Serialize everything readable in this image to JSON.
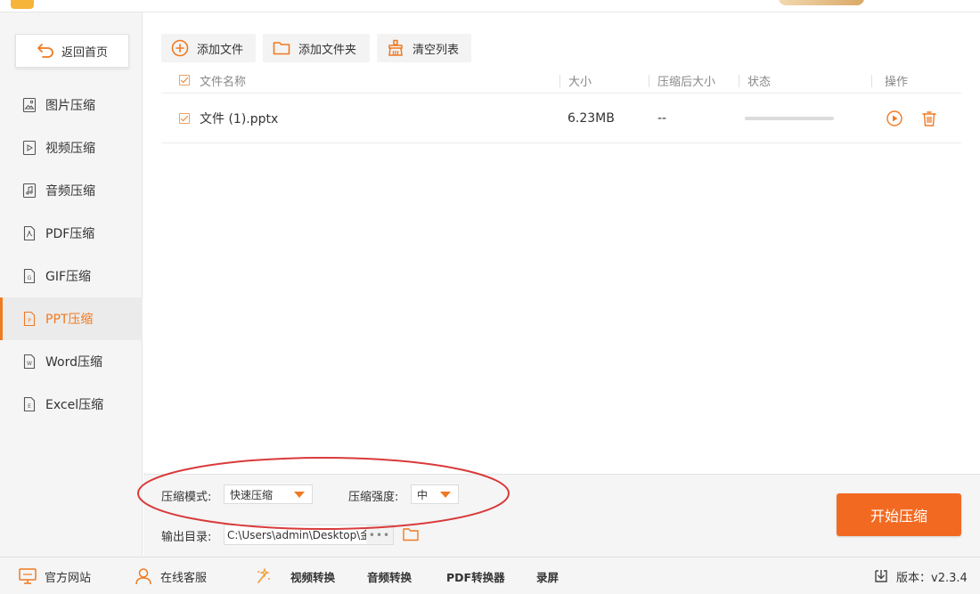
{
  "sidebar": {
    "back_label": "返回首页",
    "items": [
      {
        "label": "图片压缩",
        "icon": "image-file-icon"
      },
      {
        "label": "视频压缩",
        "icon": "video-file-icon"
      },
      {
        "label": "音频压缩",
        "icon": "audio-file-icon"
      },
      {
        "label": "PDF压缩",
        "icon": "pdf-file-icon"
      },
      {
        "label": "GIF压缩",
        "icon": "gif-file-icon"
      },
      {
        "label": "PPT压缩",
        "icon": "ppt-file-icon",
        "active": true
      },
      {
        "label": "Word压缩",
        "icon": "word-file-icon"
      },
      {
        "label": "Excel压缩",
        "icon": "excel-file-icon"
      }
    ]
  },
  "toolbar": {
    "add_file": "添加文件",
    "add_folder": "添加文件夹",
    "clear_list": "清空列表"
  },
  "table": {
    "columns": {
      "name": "文件名称",
      "size": "大小",
      "compressed_size": "压缩后大小",
      "status": "状态",
      "actions": "操作"
    },
    "rows": [
      {
        "name": "文件 (1).pptx",
        "size": "6.23MB",
        "compressed_size": "--",
        "progress": 0,
        "checked": true
      }
    ]
  },
  "options": {
    "mode_label": "压缩模式:",
    "mode_value": "快速压缩",
    "strength_label": "压缩强度:",
    "strength_value": "中",
    "output_label": "输出目录:",
    "output_path": "C:\\Users\\admin\\Desktop\\金",
    "more": "•••",
    "start_label": "开始压缩"
  },
  "footer": {
    "website": "官方网站",
    "support": "在线客服",
    "links": [
      "视频转换",
      "音频转换",
      "PDF转换器",
      "录屏"
    ],
    "version": "版本：v2.3.4"
  },
  "colors": {
    "accent": "#f07a22",
    "start_button": "#f26a22",
    "annotation": "#d93a3a"
  }
}
